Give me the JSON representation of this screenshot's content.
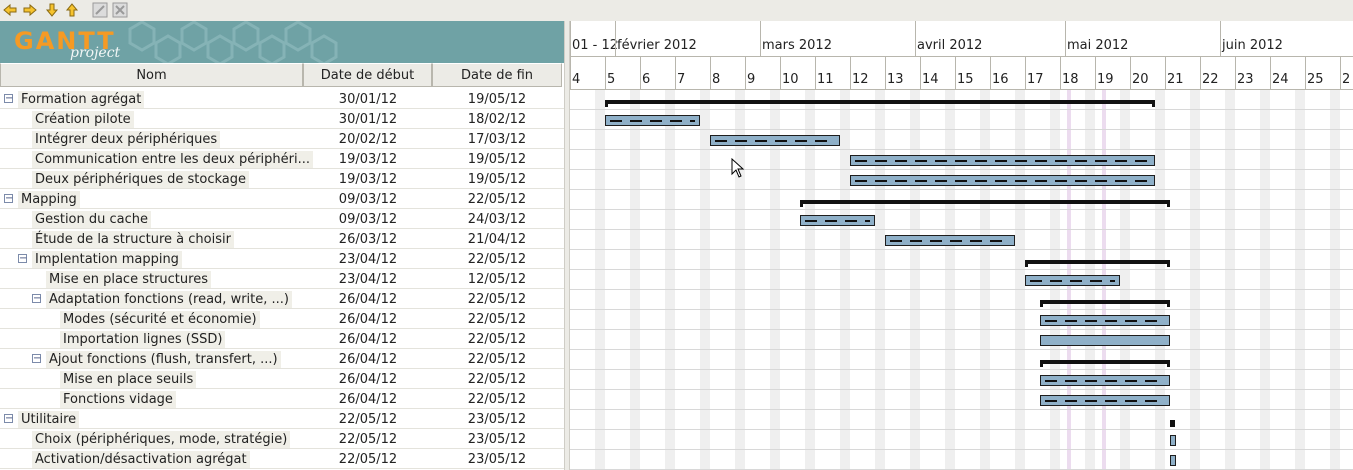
{
  "toolbar": {
    "buttons": [
      "arrow-left-icon",
      "arrow-right-icon",
      "arrow-down-icon",
      "arrow-up-icon",
      "link-icon",
      "unlink-icon"
    ]
  },
  "logo": {
    "main": "GANTT",
    "sub": "project"
  },
  "table": {
    "headers": {
      "name": "Nom",
      "start": "Date de début",
      "end": "Date de fin"
    },
    "rows": [
      {
        "name": "Formation agrégat",
        "start": "30/01/12",
        "end": "19/05/12",
        "level": 0,
        "summary": true
      },
      {
        "name": "Création pilote",
        "start": "30/01/12",
        "end": "18/02/12",
        "level": 1,
        "summary": false
      },
      {
        "name": "Intégrer deux périphériques",
        "start": "20/02/12",
        "end": "17/03/12",
        "level": 1,
        "summary": false
      },
      {
        "name": "Communication entre les deux périphéri...",
        "start": "19/03/12",
        "end": "19/05/12",
        "level": 1,
        "summary": false
      },
      {
        "name": "Deux périphériques de stockage",
        "start": "19/03/12",
        "end": "19/05/12",
        "level": 1,
        "summary": false
      },
      {
        "name": "Mapping",
        "start": "09/03/12",
        "end": "22/05/12",
        "level": 0,
        "summary": true
      },
      {
        "name": "Gestion du cache",
        "start": "09/03/12",
        "end": "24/03/12",
        "level": 1,
        "summary": false
      },
      {
        "name": "Étude de la structure à choisir",
        "start": "26/03/12",
        "end": "21/04/12",
        "level": 1,
        "summary": false
      },
      {
        "name": "Implentation mapping",
        "start": "23/04/12",
        "end": "22/05/12",
        "level": 1,
        "summary": true
      },
      {
        "name": "Mise en place structures",
        "start": "23/04/12",
        "end": "12/05/12",
        "level": 2,
        "summary": false
      },
      {
        "name": "Adaptation fonctions (read, write, ...)",
        "start": "26/04/12",
        "end": "22/05/12",
        "level": 2,
        "summary": true
      },
      {
        "name": "Modes (sécurité et économie)",
        "start": "26/04/12",
        "end": "22/05/12",
        "level": 3,
        "summary": false
      },
      {
        "name": "Importation lignes (SSD)",
        "start": "26/04/12",
        "end": "22/05/12",
        "level": 3,
        "summary": false
      },
      {
        "name": "Ajout fonctions (flush, transfert, ...)",
        "start": "26/04/12",
        "end": "22/05/12",
        "level": 2,
        "summary": true
      },
      {
        "name": "Mise en place seuils",
        "start": "26/04/12",
        "end": "22/05/12",
        "level": 3,
        "summary": false
      },
      {
        "name": "Fonctions vidage",
        "start": "26/04/12",
        "end": "22/05/12",
        "level": 3,
        "summary": false
      },
      {
        "name": "Utilitaire",
        "start": "22/05/12",
        "end": "23/05/12",
        "level": 0,
        "summary": true
      },
      {
        "name": "Choix (périphériques, mode, stratégie)",
        "start": "22/05/12",
        "end": "23/05/12",
        "level": 1,
        "summary": false
      },
      {
        "name": "Activation/désactivation agrégat",
        "start": "22/05/12",
        "end": "23/05/12",
        "level": 1,
        "summary": false
      }
    ]
  },
  "gantt": {
    "months": [
      "01 - 12",
      "février 2012",
      "mars 2012",
      "avril 2012",
      "mai 2012",
      "juin 2012"
    ],
    "weeks": [
      "4",
      "5",
      "6",
      "7",
      "8",
      "9",
      "10",
      "11",
      "12",
      "13",
      "14",
      "15",
      "16",
      "17",
      "18",
      "19",
      "20",
      "21",
      "22",
      "23",
      "24",
      "25",
      "2"
    ],
    "colors": {
      "bar": "#8fb0c8",
      "summary": "#111111",
      "logo_bg": "#6fa2a5",
      "logo_accent": "#f59a24"
    }
  }
}
